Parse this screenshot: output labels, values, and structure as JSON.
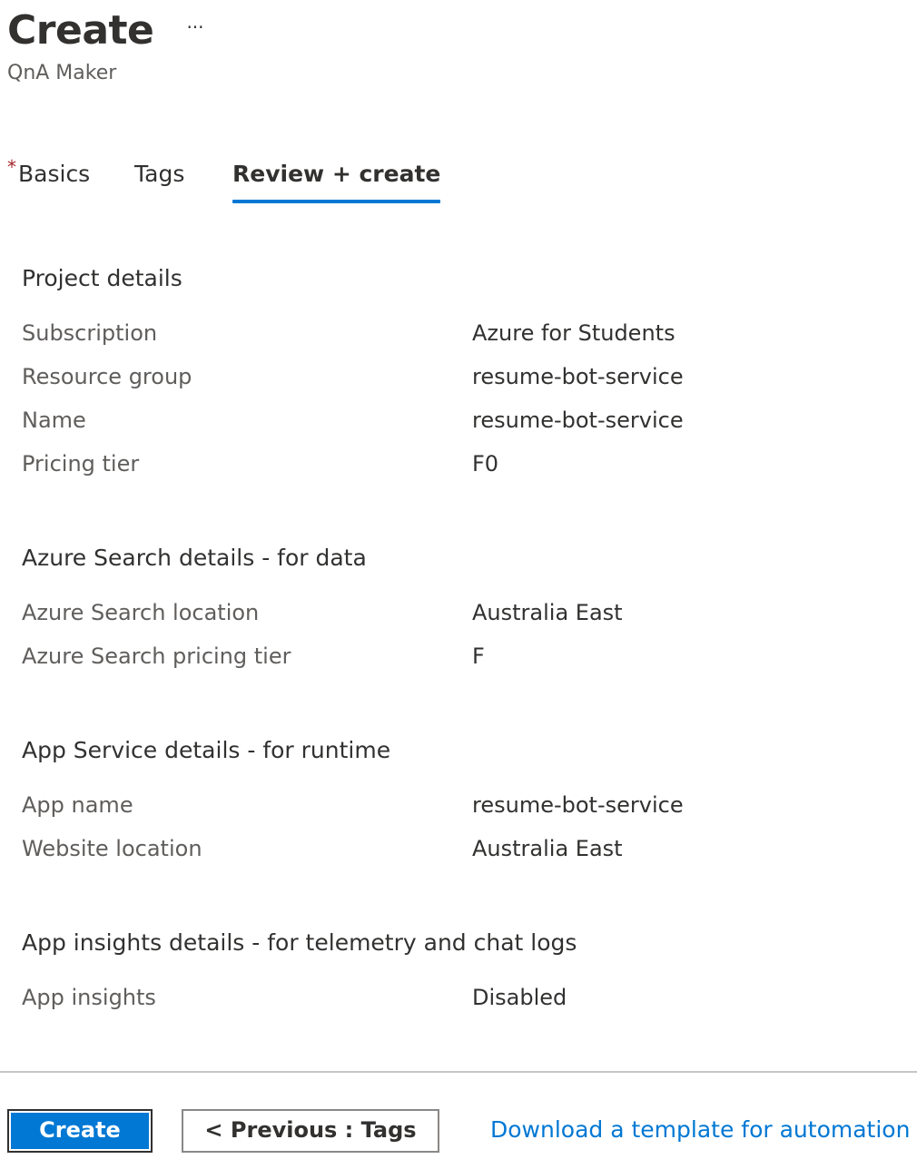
{
  "header": {
    "title": "Create",
    "more_label": "···",
    "subtitle": "QnA Maker"
  },
  "tabs": [
    {
      "label": "Basics",
      "required_marker": "*",
      "active": false
    },
    {
      "label": "Tags",
      "active": false
    },
    {
      "label": "Review + create",
      "active": true
    }
  ],
  "sections": [
    {
      "title": "Project details",
      "rows": [
        {
          "label": "Subscription",
          "value": "Azure for Students"
        },
        {
          "label": "Resource group",
          "value": "resume-bot-service"
        },
        {
          "label": "Name",
          "value": "resume-bot-service"
        },
        {
          "label": "Pricing tier",
          "value": "F0"
        }
      ]
    },
    {
      "title": "Azure Search details - for data",
      "rows": [
        {
          "label": "Azure Search location",
          "value": "Australia East"
        },
        {
          "label": "Azure Search pricing tier",
          "value": "F"
        }
      ]
    },
    {
      "title": "App Service details - for runtime",
      "rows": [
        {
          "label": "App name",
          "value": "resume-bot-service"
        },
        {
          "label": "Website location",
          "value": "Australia East"
        }
      ]
    },
    {
      "title": "App insights details - for telemetry and chat logs",
      "rows": [
        {
          "label": "App insights",
          "value": "Disabled"
        }
      ]
    }
  ],
  "footer": {
    "create_label": "Create",
    "previous_label": "< Previous : Tags",
    "download_label": "Download a template for automation"
  },
  "colors": {
    "accent": "#0078d4",
    "required": "#a4262c",
    "text": "#323130",
    "muted_text": "#605e5c"
  }
}
